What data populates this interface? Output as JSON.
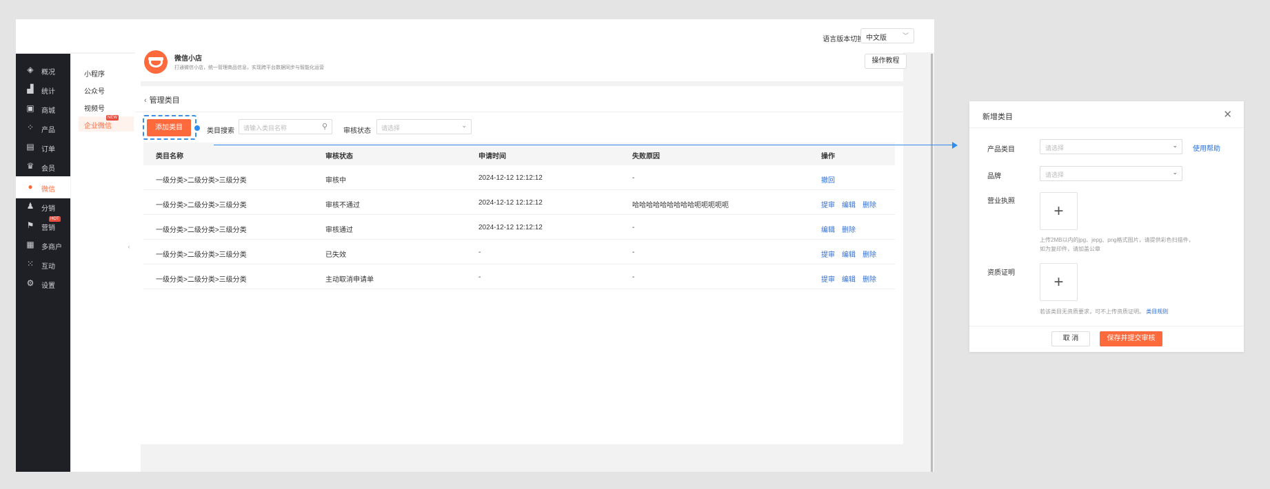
{
  "header": {
    "lang_label": "语言版本切换:",
    "lang_value": "中文版"
  },
  "sidebar": {
    "items": [
      {
        "label": "概况",
        "icon": "layers-icon"
      },
      {
        "label": "统计",
        "icon": "chart-icon"
      },
      {
        "label": "商城",
        "icon": "store-icon"
      },
      {
        "label": "产品",
        "icon": "grid-icon"
      },
      {
        "label": "订单",
        "icon": "clipboard-icon"
      },
      {
        "label": "会员",
        "icon": "crown-icon"
      },
      {
        "label": "微信",
        "icon": "wechat-icon"
      },
      {
        "label": "分销",
        "icon": "users-icon"
      },
      {
        "label": "营销",
        "icon": "flag-icon",
        "badge": "HOT"
      },
      {
        "label": "多商户",
        "icon": "shop-icon"
      },
      {
        "label": "互动",
        "icon": "apps-icon"
      },
      {
        "label": "设置",
        "icon": "gear-icon"
      }
    ]
  },
  "subnav": {
    "items": [
      {
        "label": "小程序"
      },
      {
        "label": "公众号"
      },
      {
        "label": "视频号"
      },
      {
        "label": "企业微信",
        "badge": "NEW"
      }
    ]
  },
  "banner": {
    "title": "微信小店",
    "desc": "打通微信小店，统一管理商品信息，实现跨平台数据同步与智能化运营",
    "tutorial_button": "操作教程"
  },
  "panel": {
    "back_label": "管理类目",
    "add_button": "添加类目",
    "search_label": "类目搜索",
    "search_placeholder": "请输入类目名称",
    "status_label": "审核状态",
    "status_placeholder": "请选择"
  },
  "table": {
    "headers": [
      "类目名称",
      "审核状态",
      "申请时间",
      "失败原因",
      "操作"
    ],
    "rows": [
      {
        "name": "一级分类>二级分类>三级分类",
        "status": "审核中",
        "time": "2024-12-12 12:12:12",
        "reason": "-",
        "actions": [
          "撤回"
        ]
      },
      {
        "name": "一级分类>二级分类>三级分类",
        "status": "审核不通过",
        "time": "2024-12-12 12:12:12",
        "reason": "哈哈哈哈哈哈哈哈哈呃呃呃呃呃",
        "actions": [
          "提审",
          "编辑",
          "删除"
        ]
      },
      {
        "name": "一级分类>二级分类>三级分类",
        "status": "审核通过",
        "time": "2024-12-12 12:12:12",
        "reason": "-",
        "actions": [
          "编辑",
          "删除"
        ]
      },
      {
        "name": "一级分类>二级分类>三级分类",
        "status": "已失效",
        "time": "-",
        "reason": "-",
        "actions": [
          "提审",
          "编辑",
          "删除"
        ]
      },
      {
        "name": "一级分类>二级分类>三级分类",
        "status": "主动取消申请单",
        "time": "-",
        "reason": "-",
        "actions": [
          "提审",
          "编辑",
          "删除"
        ]
      }
    ]
  },
  "dialog": {
    "title": "新增类目",
    "product_category_label": "产品类目",
    "product_category_placeholder": "请选择",
    "help_link": "使用帮助",
    "brand_label": "品牌",
    "brand_placeholder": "请选择",
    "license_label": "营业执照",
    "license_hint_1": "上传2MB以内的jpg、jepg、png格式图片，请提供彩色扫描件，",
    "license_hint_2": "如为复印件，请加盖公章",
    "qualification_label": "资质证明",
    "qualification_hint": "若该类目无资质要求，可不上传资质证明。",
    "qualification_link": "类目规则",
    "cancel_button": "取 消",
    "submit_button": "保存并提交审核"
  }
}
